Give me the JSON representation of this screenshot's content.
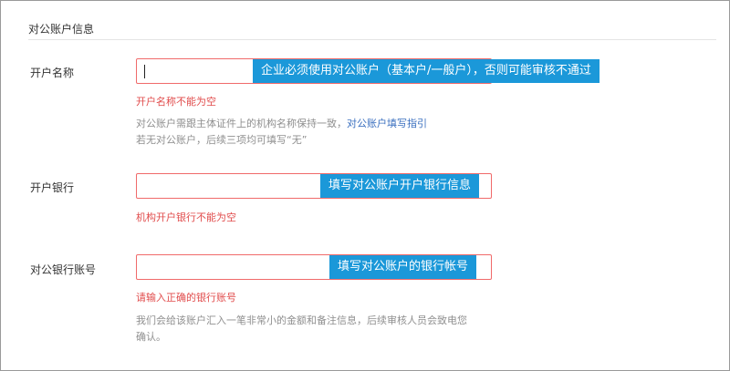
{
  "section": {
    "title": "对公账户信息"
  },
  "fields": {
    "account_name": {
      "label": "开户名称",
      "value": "",
      "hint": "企业必须使用对公账户（基本户/一般户），否则可能审核不通过",
      "error": "开户名称不能为空",
      "help_line1_prefix": "对公账户需跟主体证件上的机构名称保持一致，",
      "help_link": "对公账户填写指引",
      "help_line2": "若无对公账户，后续三项均可填写“无”"
    },
    "bank": {
      "label": "开户银行",
      "value": "",
      "hint": "填写对公账户开户银行信息",
      "error": "机构开户银行不能为空"
    },
    "account_number": {
      "label": "对公银行账号",
      "value": "",
      "hint": "填写对公账户的银行帐号",
      "error": "请输入正确的银行账号",
      "help_line1": "我们会给该账户汇入一笔非常小的金额和备注信息，后续审核人员会致电您",
      "help_line2": "确认。"
    }
  },
  "colors": {
    "hint_bg": "#1b98d9",
    "error": "#e14c4c",
    "input_border_error": "#f06a6a",
    "link": "#3a6fbf"
  }
}
